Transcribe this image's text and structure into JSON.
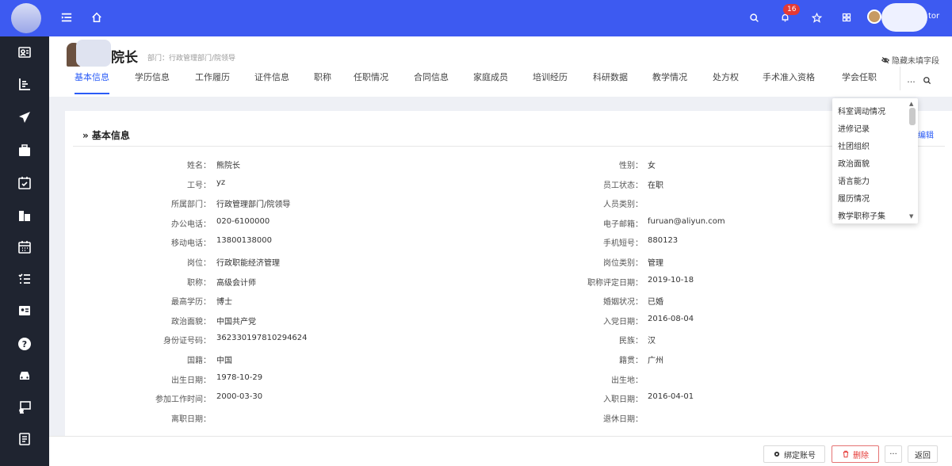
{
  "topbar": {
    "notification_count": "16",
    "user_name_suffix": "tor"
  },
  "header": {
    "name_suffix": "院长",
    "department": "部门：行政管理部门/院领导",
    "hide_empty_label": "隐藏未填字段"
  },
  "tabs": [
    {
      "label": "基本信息"
    },
    {
      "label": "学历信息"
    },
    {
      "label": "工作履历"
    },
    {
      "label": "证件信息"
    },
    {
      "label": "职称"
    },
    {
      "label": "任职情况"
    },
    {
      "label": "合同信息"
    },
    {
      "label": "家庭成员"
    },
    {
      "label": "培训经历"
    },
    {
      "label": "科研数据"
    },
    {
      "label": "教学情况"
    },
    {
      "label": "处方权"
    },
    {
      "label": "手术准入资格"
    },
    {
      "label": "学会任职"
    }
  ],
  "tab_more_label": "...",
  "section": {
    "title": "» 基本信息",
    "edit_label": "编辑"
  },
  "left_fields": [
    {
      "label": "姓名：",
      "value": "熊院长"
    },
    {
      "label": "工号：",
      "value": "yz"
    },
    {
      "label": "所属部门：",
      "value": "行政管理部门/院领导"
    },
    {
      "label": "办公电话：",
      "value": "020-6100000"
    },
    {
      "label": "移动电话：",
      "value": "13800138000"
    },
    {
      "label": "岗位：",
      "value": "行政职能经济管理"
    },
    {
      "label": "职称：",
      "value": "高级会计师"
    },
    {
      "label": "最高学历：",
      "value": "博士"
    },
    {
      "label": "政治面貌：",
      "value": "中国共产党"
    },
    {
      "label": "身份证号码：",
      "value": "362330197810294624"
    },
    {
      "label": "国籍：",
      "value": "中国"
    },
    {
      "label": "出生日期：",
      "value": "1978-10-29"
    },
    {
      "label": "参加工作时间：",
      "value": "2000-03-30"
    },
    {
      "label": "离职日期：",
      "value": ""
    }
  ],
  "right_fields": [
    {
      "label": "性别：",
      "value": "女"
    },
    {
      "label": "员工状态：",
      "value": "在职"
    },
    {
      "label": "人员类别：",
      "value": ""
    },
    {
      "label": "电子邮箱：",
      "value": "furuan@aliyun.com"
    },
    {
      "label": "手机短号：",
      "value": "880123"
    },
    {
      "label": "岗位类别：",
      "value": "管理"
    },
    {
      "label": "职称评定日期：",
      "value": "2019-10-18"
    },
    {
      "label": "婚姻状况：",
      "value": "已婚"
    },
    {
      "label": "入党日期：",
      "value": "2016-08-04"
    },
    {
      "label": "民族：",
      "value": "汉"
    },
    {
      "label": "籍贯：",
      "value": "广州"
    },
    {
      "label": "出生地：",
      "value": ""
    },
    {
      "label": "入职日期：",
      "value": "2016-04-01"
    },
    {
      "label": "退休日期：",
      "value": ""
    }
  ],
  "dropdown": [
    {
      "label": "科室调动情况"
    },
    {
      "label": "进修记录"
    },
    {
      "label": "社团组织"
    },
    {
      "label": "政治面貌"
    },
    {
      "label": "语言能力"
    },
    {
      "label": "履历情况"
    },
    {
      "label": "教学职称子集"
    }
  ],
  "footer": {
    "bind_account_label": "绑定账号",
    "delete_label": "删除",
    "more_label": "···",
    "back_label": "返回"
  }
}
